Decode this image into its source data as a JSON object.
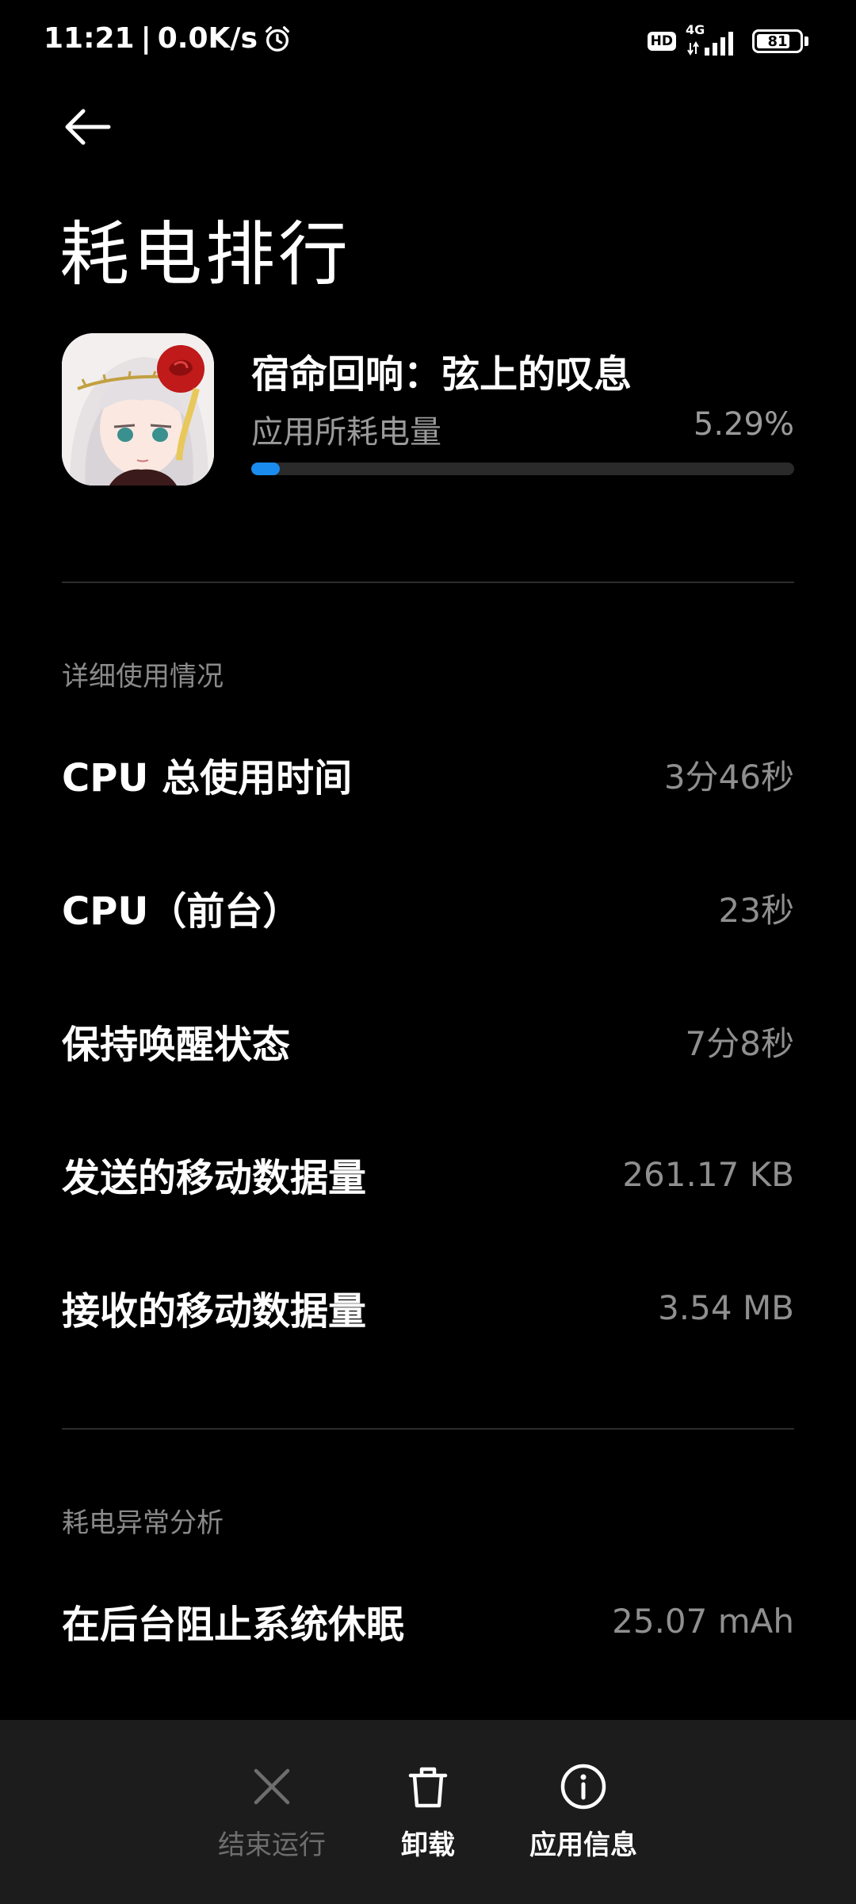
{
  "status_bar": {
    "time": "11:21",
    "network_speed": "0.0K/s",
    "hd_label": "HD",
    "network_type": "4G",
    "battery_level": "81"
  },
  "header": {
    "back_icon": "arrow-left-icon",
    "title": "耗电排行"
  },
  "app": {
    "name": "宿命回响：弦上的叹息",
    "usage_label": "应用所耗电量",
    "usage_percent": "5.29%",
    "usage_fraction": 0.0529,
    "accent_color": "#1a8cf0"
  },
  "details": {
    "section_title": "详细使用情况",
    "rows": [
      {
        "label": "CPU 总使用时间",
        "value": "3分46秒"
      },
      {
        "label": "CPU（前台）",
        "value": "23秒"
      },
      {
        "label": "保持唤醒状态",
        "value": "7分8秒"
      },
      {
        "label": "发送的移动数据量",
        "value": "261.17 KB"
      },
      {
        "label": "接收的移动数据量",
        "value": "3.54 MB"
      }
    ]
  },
  "anomaly": {
    "section_title": "耗电异常分析",
    "rows": [
      {
        "label": "在后台阻止系统休眠",
        "value": "25.07 mAh"
      }
    ]
  },
  "actions": {
    "force_stop": {
      "label": "结束运行",
      "icon": "close-icon",
      "enabled": false
    },
    "uninstall": {
      "label": "卸载",
      "icon": "trash-icon",
      "enabled": true
    },
    "app_info": {
      "label": "应用信息",
      "icon": "info-icon",
      "enabled": true
    }
  }
}
